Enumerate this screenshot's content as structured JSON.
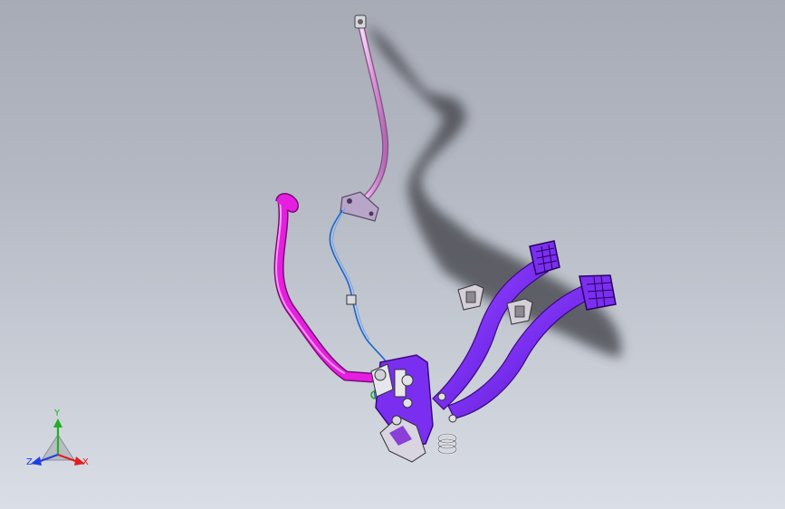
{
  "colors": {
    "background_top": "#a7abb5",
    "background_bottom": "#dadee6",
    "brake_pedal": "#7a2ff0",
    "pedal_dark": "#4b12a8",
    "rod_magenta": "#e61ee0",
    "hose_pink": "#e8c2e8",
    "wire_blue": "#1f64c8",
    "shadow": "#3c3e44",
    "axis_x": "#e02020",
    "axis_y": "#20b020",
    "axis_z": "#2040e0"
  },
  "icons": [
    "pedal-assembly-model",
    "orientation-triad-icon"
  ],
  "triad": {
    "x_label": "X",
    "y_label": "Y",
    "z_label": "Z"
  }
}
